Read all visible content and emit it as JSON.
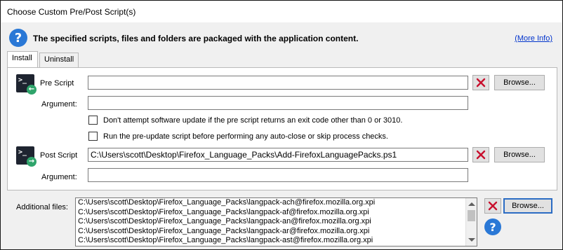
{
  "window": {
    "title": "Choose Custom Pre/Post Script(s)"
  },
  "info": {
    "message": "The specified scripts, files and folders are packaged with the application content.",
    "more_info_link": "(More Info)"
  },
  "tabs": [
    {
      "label": "Install",
      "active": true
    },
    {
      "label": "Uninstall",
      "active": false
    }
  ],
  "pre_script": {
    "label": "Pre Script",
    "value": "",
    "argument_label": "Argument:",
    "argument_value": "",
    "browse_label": "Browse..."
  },
  "options": [
    {
      "label": "Don't attempt software update if the pre script returns an exit code other than 0 or 3010.",
      "checked": false
    },
    {
      "label": "Run the pre-update script before performing any auto-close or skip process checks.",
      "checked": false
    }
  ],
  "post_script": {
    "label": "Post Script",
    "value": "C:\\Users\\scott\\Desktop\\Firefox_Language_Packs\\Add-FirefoxLanguagePacks.ps1",
    "argument_label": "Argument:",
    "argument_value": "",
    "browse_label": "Browse..."
  },
  "additional_files": {
    "label": "Additional files:",
    "browse_label": "Browse...",
    "items": [
      "C:\\Users\\scott\\Desktop\\Firefox_Language_Packs\\langpack-ach@firefox.mozilla.org.xpi",
      "C:\\Users\\scott\\Desktop\\Firefox_Language_Packs\\langpack-af@firefox.mozilla.org.xpi",
      "C:\\Users\\scott\\Desktop\\Firefox_Language_Packs\\langpack-an@firefox.mozilla.org.xpi",
      "C:\\Users\\scott\\Desktop\\Firefox_Language_Packs\\langpack-ar@firefox.mozilla.org.xpi",
      "C:\\Users\\scott\\Desktop\\Firefox_Language_Packs\\langpack-ast@firefox.mozilla.org.xpi"
    ]
  },
  "icons": {
    "help": "help-icon",
    "clear": "red-x-icon",
    "script": "powershell-script-icon"
  },
  "colors": {
    "help_blue": "#2a78d6",
    "clear_red": "#c8102e",
    "link_blue": "#0033cc",
    "script_badge_green": "#2fa46b"
  }
}
